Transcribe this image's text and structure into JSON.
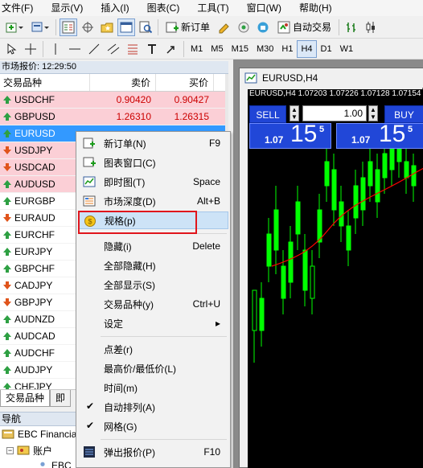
{
  "menubar": [
    "文件(F)",
    "显示(V)",
    "插入(I)",
    "图表(C)",
    "工具(T)",
    "窗口(W)",
    "帮助(H)"
  ],
  "toolbar": {
    "new_order": "新订单",
    "auto_trading": "自动交易",
    "timeframes": [
      "M1",
      "M5",
      "M15",
      "M30",
      "H1",
      "H4",
      "D1",
      "W1"
    ],
    "active_timeframe": "H4"
  },
  "market_watch": {
    "title": "市场报价: 12:29:50",
    "columns": {
      "symbol": "交易品种",
      "bid": "卖价",
      "ask": "买价"
    },
    "rows": [
      {
        "symbol": "USDCHF",
        "bid": "0.90420",
        "ask": "0.90427",
        "dir": "up",
        "style": "pink"
      },
      {
        "symbol": "GBPUSD",
        "bid": "1.26310",
        "ask": "1.26315",
        "dir": "up",
        "style": "pink"
      },
      {
        "symbol": "EURUSD",
        "bid": "",
        "ask": "",
        "dir": "up",
        "style": "selected"
      },
      {
        "symbol": "USDJPY",
        "bid": "",
        "ask": "",
        "dir": "down",
        "style": "pink"
      },
      {
        "symbol": "USDCAD",
        "bid": "",
        "ask": "",
        "dir": "down",
        "style": "pink"
      },
      {
        "symbol": "AUDUSD",
        "bid": "",
        "ask": "",
        "dir": "up",
        "style": "pink"
      },
      {
        "symbol": "EURGBP",
        "bid": "",
        "ask": "",
        "dir": "up",
        "style": "plain"
      },
      {
        "symbol": "EURAUD",
        "bid": "",
        "ask": "",
        "dir": "down",
        "style": "plain"
      },
      {
        "symbol": "EURCHF",
        "bid": "",
        "ask": "",
        "dir": "up",
        "style": "plain"
      },
      {
        "symbol": "EURJPY",
        "bid": "",
        "ask": "",
        "dir": "up",
        "style": "plain"
      },
      {
        "symbol": "GBPCHF",
        "bid": "",
        "ask": "",
        "dir": "up",
        "style": "plain"
      },
      {
        "symbol": "CADJPY",
        "bid": "",
        "ask": "",
        "dir": "down",
        "style": "plain"
      },
      {
        "symbol": "GBPJPY",
        "bid": "",
        "ask": "",
        "dir": "down",
        "style": "plain"
      },
      {
        "symbol": "AUDNZD",
        "bid": "",
        "ask": "",
        "dir": "up",
        "style": "plain"
      },
      {
        "symbol": "AUDCAD",
        "bid": "",
        "ask": "",
        "dir": "up",
        "style": "plain"
      },
      {
        "symbol": "AUDCHF",
        "bid": "",
        "ask": "",
        "dir": "up",
        "style": "plain"
      },
      {
        "symbol": "AUDJPY",
        "bid": "",
        "ask": "",
        "dir": "up",
        "style": "plain"
      },
      {
        "symbol": "CHFJPY",
        "bid": "",
        "ask": "",
        "dir": "up",
        "style": "plain"
      }
    ],
    "tabs": [
      "交易品种",
      "即"
    ]
  },
  "navigator": {
    "title": "导航",
    "items": [
      "EBC Financia",
      "账户",
      "EBC"
    ]
  },
  "chart": {
    "window_title": "EURUSD,H4",
    "info": "EURUSD,H4  1.07203 1.07226 1.07128 1.07154",
    "sell_label": "SELL",
    "buy_label": "BUY",
    "lot": "1.00",
    "sell_prefix": "1.07",
    "sell_big": "15",
    "sell_sup": "5",
    "buy_prefix": "1.07",
    "buy_big": "15",
    "buy_sup": "5",
    "bull_color": "#00ff00",
    "ma_color": "#ff0000"
  },
  "context_menu": [
    {
      "label": "新订单(N)",
      "key": "F9",
      "icon": "new-order-icon"
    },
    {
      "label": "图表窗口(C)",
      "key": "",
      "icon": "chart-window-icon"
    },
    {
      "label": "即时图(T)",
      "key": "Space",
      "icon": "tick-chart-icon"
    },
    {
      "label": "市场深度(D)",
      "key": "Alt+B",
      "icon": "market-depth-icon"
    },
    {
      "label": "规格(p)",
      "key": "",
      "icon": "specification-icon",
      "highlight": true
    },
    {
      "sep": true
    },
    {
      "label": "隐藏(i)",
      "key": "Delete"
    },
    {
      "label": "全部隐藏(H)",
      "key": ""
    },
    {
      "label": "全部显示(S)",
      "key": ""
    },
    {
      "label": "交易品种(y)",
      "key": "Ctrl+U"
    },
    {
      "label": "设定",
      "key": "▸"
    },
    {
      "sep": true
    },
    {
      "label": "点差(r)",
      "key": ""
    },
    {
      "label": "最高价/最低价(L)",
      "key": ""
    },
    {
      "label": "时间(m)",
      "key": ""
    },
    {
      "label": "自动排列(A)",
      "key": "",
      "check": true
    },
    {
      "label": "网格(G)",
      "key": "",
      "check": true
    },
    {
      "sep": true
    },
    {
      "label": "弹出报价(P)",
      "key": "F10",
      "icon": "popup-prices-icon"
    }
  ]
}
